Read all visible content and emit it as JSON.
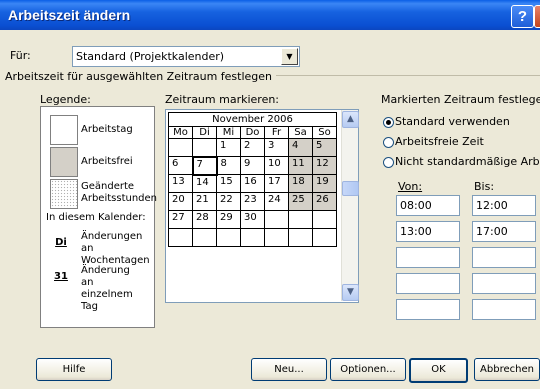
{
  "window": {
    "title": "Arbeitszeit ändern",
    "help_glyph": "?",
    "close_glyph": "X"
  },
  "fuer": {
    "label": "Für:",
    "value": "Standard (Projektkalender)",
    "arrow": "▼"
  },
  "group_label": "Arbeitszeit für ausgewählten Zeitraum festlegen",
  "legend": {
    "title": "Legende:",
    "items": [
      "Arbeitstag",
      "Arbeitsfrei",
      "Geänderte Arbeitsstunden"
    ],
    "in_calendar_label": "In diesem Kalender:",
    "marker_di": "Di",
    "changes_weekday": "Änderungen an Wochentagen",
    "marker_31": "31",
    "change_day": "Änderung an einzelnem Tag"
  },
  "calendar": {
    "label": "Zeitraum markieren:",
    "month": "November 2006",
    "headers": [
      "Mo",
      "Di",
      "Mi",
      "Do",
      "Fr",
      "Sa",
      "So"
    ],
    "weeks": [
      [
        "",
        "",
        "1",
        "2",
        "3",
        "4",
        "5"
      ],
      [
        "6",
        "7",
        "8",
        "9",
        "10",
        "11",
        "12"
      ],
      [
        "13",
        "14",
        "15",
        "16",
        "17",
        "18",
        "19"
      ],
      [
        "20",
        "21",
        "22",
        "23",
        "24",
        "25",
        "26"
      ],
      [
        "27",
        "28",
        "29",
        "30",
        "",
        "",
        ""
      ],
      [
        "",
        "",
        "",
        "",
        "",
        "",
        ""
      ]
    ],
    "selected_day": "7",
    "scroll_up": "▲",
    "scroll_down": "▼"
  },
  "right": {
    "title": "Markierten Zeitraum festlegen:",
    "radio_standard": "Standard verwenden",
    "radio_free": "Arbeitsfreie Zeit",
    "radio_nonstd": "Nicht standardmäßige Arbeitsz",
    "von_label": "Von:",
    "bis_label": "Bis:",
    "von_values": [
      "08:00",
      "13:00",
      "",
      "",
      ""
    ],
    "bis_values": [
      "12:00",
      "17:00",
      "",
      "",
      ""
    ]
  },
  "buttons": {
    "help": "Hilfe",
    "new": "Neu...",
    "options": "Optionen...",
    "ok": "OK",
    "cancel": "Abbrechen"
  }
}
